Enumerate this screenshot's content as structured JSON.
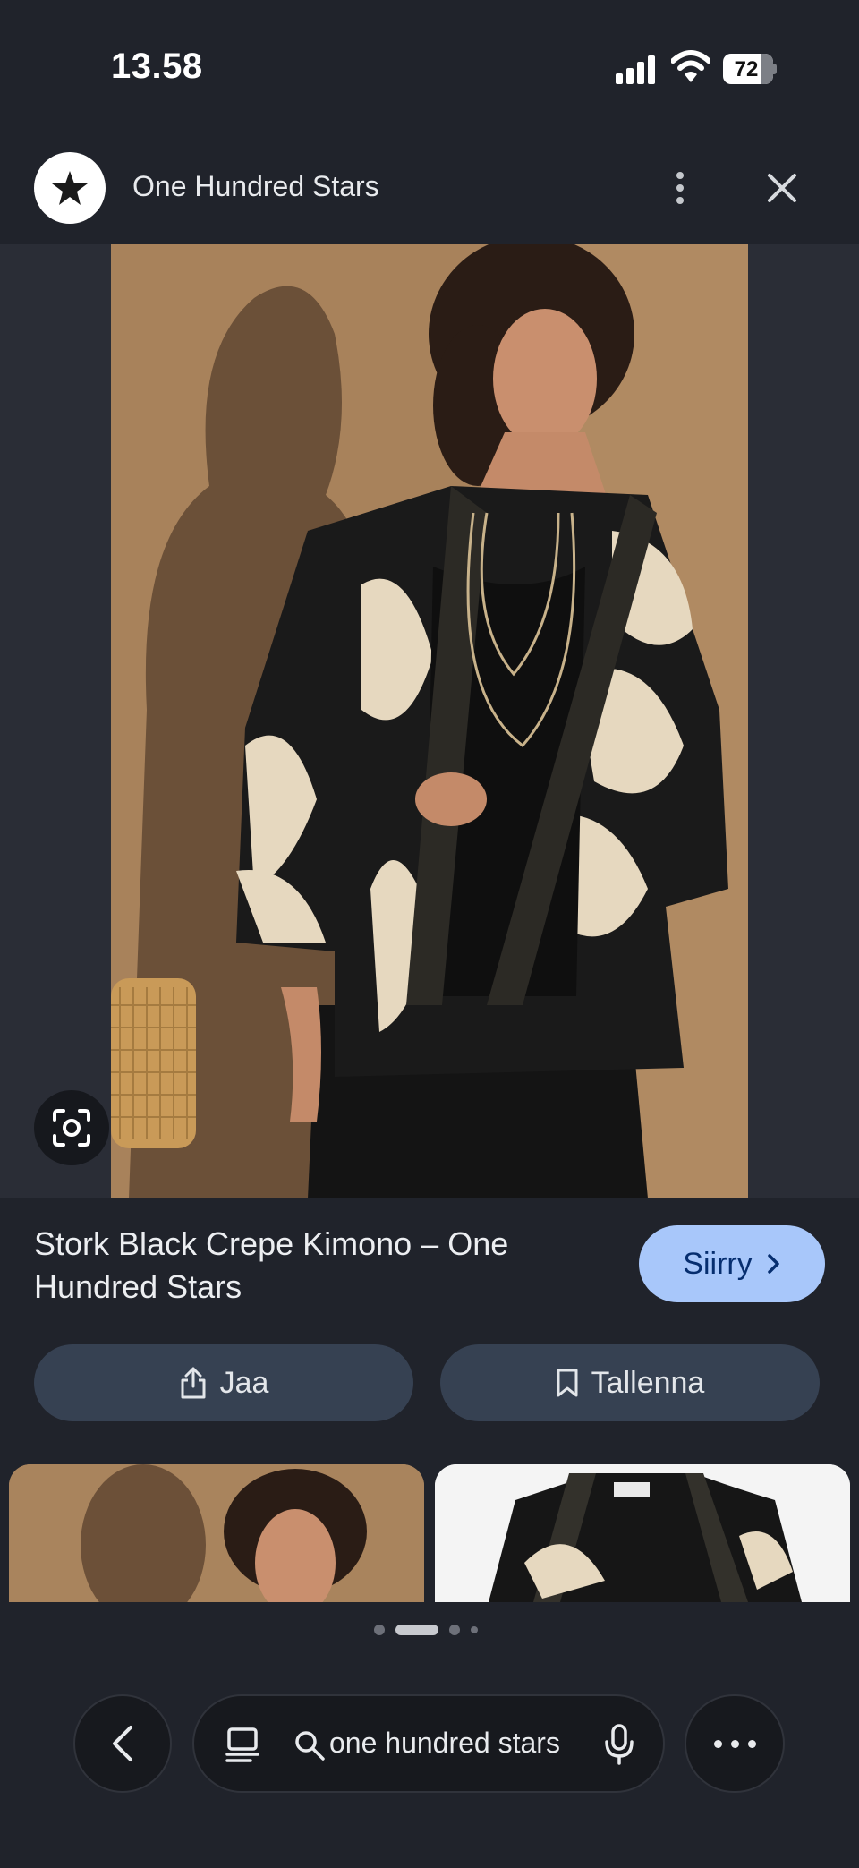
{
  "status_bar": {
    "time": "13.58",
    "battery": "72"
  },
  "header": {
    "site_name": "One Hundred Stars",
    "logo_icon": "star-icon",
    "more_icon": "more-vertical-icon",
    "close_icon": "close-icon"
  },
  "result": {
    "title": "Stork Black Crepe Kimono – One Hundred Stars",
    "visit_label": "Siirry",
    "share_label": "Jaa",
    "save_label": "Tallenna"
  },
  "carousel": {
    "page_count": 4,
    "active_page": 2
  },
  "bottom_bar": {
    "search_query": "one hundred stars"
  },
  "colors": {
    "background": "#20232b",
    "visit_button": "#a8c7fa",
    "action_button": "#364152"
  }
}
